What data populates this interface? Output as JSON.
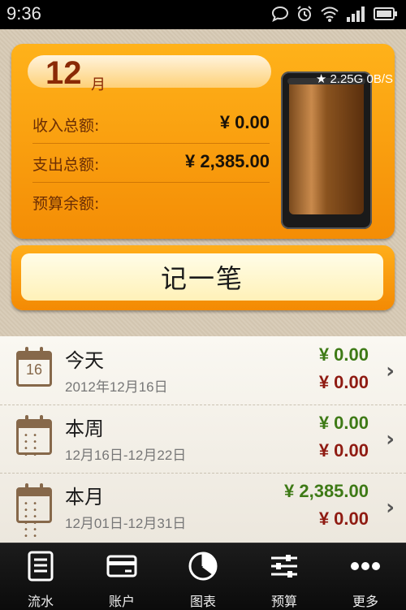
{
  "status_bar": {
    "time": "9:36",
    "icons": [
      "chat-bubble-icon",
      "alarm-icon",
      "wifi-icon",
      "signal-icon",
      "battery-icon"
    ]
  },
  "summary": {
    "month_number": "12",
    "month_unit": "月",
    "income_label": "收入总额:",
    "income_value": "¥ 0.00",
    "expense_label": "支出总额:",
    "expense_value": "¥ 2,385.00",
    "budget_label": "预算余额:",
    "budget_value": "",
    "net_speed": "★ 2.25G  0B/S"
  },
  "record_button": {
    "label": "记一笔"
  },
  "periods": [
    {
      "title": "今天",
      "range": "2012年12月16日",
      "calendar": "16",
      "income": "¥ 0.00",
      "expense": "¥ 0.00"
    },
    {
      "title": "本周",
      "range": "12月16日-12月22日",
      "calendar": "",
      "income": "¥ 0.00",
      "expense": "¥ 0.00"
    },
    {
      "title": "本月",
      "range": "12月01日-12月31日",
      "calendar": "",
      "income": "¥ 2,385.00",
      "expense": "¥ 0.00"
    }
  ],
  "tabs": [
    {
      "label": "流水",
      "icon": "list-icon"
    },
    {
      "label": "账户",
      "icon": "card-icon"
    },
    {
      "label": "图表",
      "icon": "pie-chart-icon"
    },
    {
      "label": "预算",
      "icon": "sliders-icon"
    },
    {
      "label": "更多",
      "icon": "more-icon"
    }
  ],
  "colors": {
    "orange": "#f9a012",
    "income_green": "#3e7a16",
    "expense_red": "#8f1b12"
  }
}
